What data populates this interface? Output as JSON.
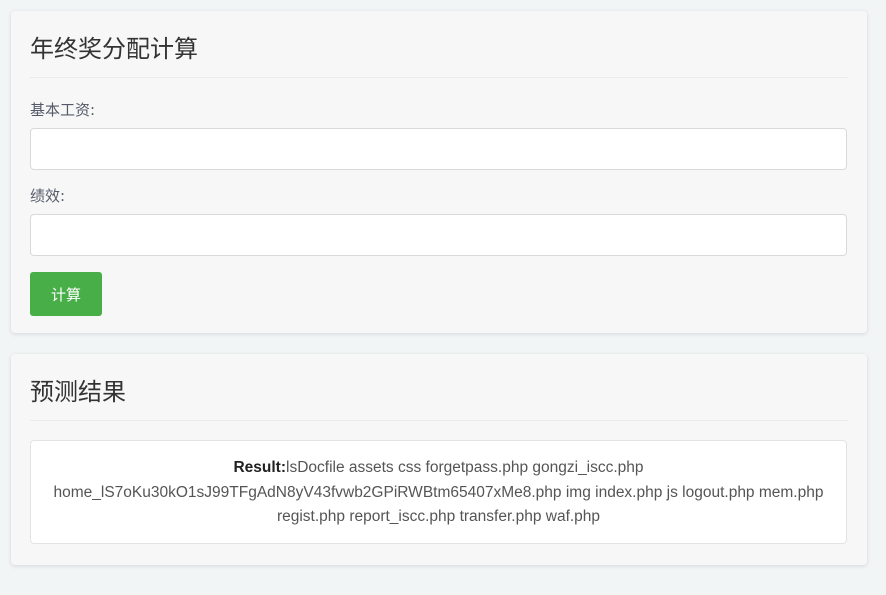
{
  "calculator": {
    "title": "年终奖分配计算",
    "base_salary_label": "基本工资:",
    "base_salary_value": "",
    "performance_label": "绩效:",
    "performance_value": "",
    "calculate_button": "计算"
  },
  "prediction": {
    "title": "预测结果",
    "result_label": "Result:",
    "result_text": "lsDocfile assets css forgetpass.php gongzi_iscc.php home_lS7oKu30kO1sJ99TFgAdN8yV43fvwb2GPiRWBtm65407xMe8.php img index.php js logout.php mem.php regist.php report_iscc.php transfer.php waf.php"
  },
  "colors": {
    "button_green": "#48ae48",
    "page_background": "#f1f5f5",
    "card_background": "#f7f7f7"
  }
}
